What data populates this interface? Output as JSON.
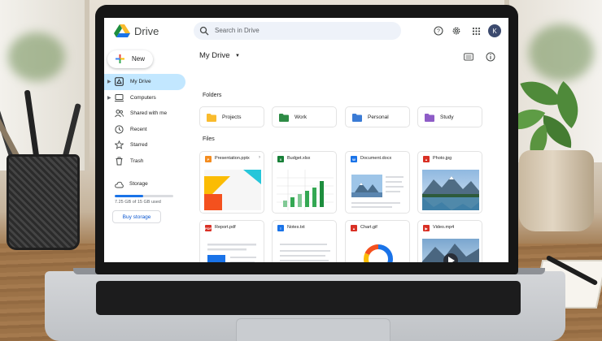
{
  "app": {
    "name": "Drive"
  },
  "search": {
    "placeholder": "Search in Drive"
  },
  "header": {
    "user_initial": "K"
  },
  "sidebar": {
    "new_label": "New",
    "items": [
      {
        "label": "My Drive",
        "icon": "my-drive-icon",
        "active": true
      },
      {
        "label": "Computers",
        "icon": "computer-icon"
      },
      {
        "label": "Shared with me",
        "icon": "people-icon"
      },
      {
        "label": "Recent",
        "icon": "clock-icon"
      },
      {
        "label": "Starred",
        "icon": "star-icon"
      },
      {
        "label": "Trash",
        "icon": "trash-icon"
      }
    ],
    "storage": {
      "title": "Storage",
      "used_text": "7.25 GB of 15 GB used",
      "fraction_used": 0.48,
      "buy_label": "Buy storage"
    }
  },
  "main": {
    "title": "My Drive",
    "folders_label": "Folders",
    "files_label": "Files",
    "folders": [
      {
        "name": "Projects",
        "color": "#f9bb2d"
      },
      {
        "name": "Work",
        "color": "#2e8b45"
      },
      {
        "name": "Personal",
        "color": "#3a7bd5"
      },
      {
        "name": "Study",
        "color": "#8e5cc7"
      }
    ],
    "files": [
      {
        "name": "Presentation.pptx",
        "type": "slides",
        "icon_color": "#f48c1f",
        "glyph": "P"
      },
      {
        "name": "Budget.xlsx",
        "type": "sheet",
        "icon_color": "#188038",
        "glyph": "X"
      },
      {
        "name": "Document.docx",
        "type": "doc",
        "icon_color": "#1a73e8",
        "glyph": "W"
      },
      {
        "name": "Photo.jpg",
        "type": "image",
        "icon_color": "#d93025",
        "glyph": "▲"
      },
      {
        "name": "Report.pdf",
        "type": "pdf",
        "icon_color": "#d93025",
        "glyph": "PDF"
      },
      {
        "name": "Notes.txt",
        "type": "text",
        "icon_color": "#1a73e8",
        "glyph": "≡"
      },
      {
        "name": "Chart.gif",
        "type": "gif",
        "icon_color": "#d93025",
        "glyph": "▲"
      },
      {
        "name": "Video.mp4",
        "type": "video",
        "icon_color": "#d93025",
        "glyph": "▶"
      }
    ]
  },
  "colors": {
    "accent": "#1a73e8",
    "active_nav": "#c2e7ff",
    "search_bg": "#eef2f9"
  }
}
